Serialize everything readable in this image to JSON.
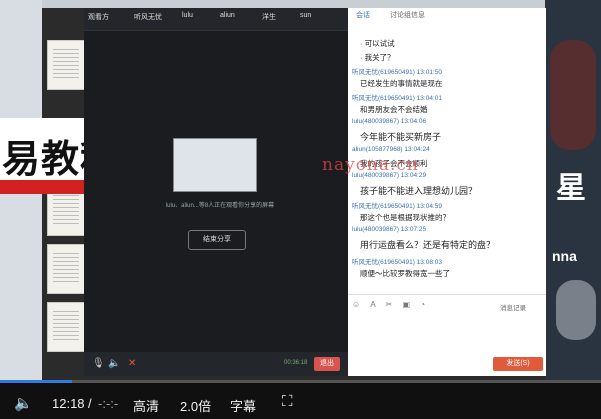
{
  "video_window": {
    "tabs": [
      "观看方",
      "听风无忧",
      "lulu",
      "aliun",
      "洋生",
      "sun"
    ],
    "share_message": "lulu、aliun...等8人正在观看你分享的屏幕",
    "end_share_button": "结束分享",
    "exit_button": "退出",
    "timer": "00:36:18"
  },
  "chat": {
    "tabs": [
      "会话",
      "讨论组信息"
    ],
    "messages": [
      {
        "meta": "",
        "text": "· 可以试试"
      },
      {
        "meta": "",
        "text": "· 我关了？"
      },
      {
        "meta": "听风无忧(619650491)  13:01:50",
        "text": "已经发生的事情就是现在"
      },
      {
        "meta": "听风无忧(619650491)  13:04:01",
        "text": "和男朋友会不会结婚"
      },
      {
        "meta": "lulu(480039867)  13:04:06",
        "text": "今年能不能买新房子"
      },
      {
        "meta": "aliun(105877968)  13:04:24",
        "text": "我的孩子会不会顺利"
      },
      {
        "meta": "lulu(480039867)  13:04:29",
        "text": "孩子能不能进入理想幼儿园？"
      },
      {
        "meta": "听风无忧(619650491)  13:04:59",
        "text": "那这个也是根据现状推的？"
      },
      {
        "meta": "lulu(480039867)  13:07:25",
        "text": "用行运盘看么？还是有特定的盘？"
      },
      {
        "meta": "听风无忧(619650491)  13:08:03",
        "text": "顺便～比较罗教得宽一些了"
      }
    ],
    "chat_history_label": "消息记录",
    "send_button": "发送(S)"
  },
  "watermark": "nayona.cn",
  "promo": {
    "text": "易教程"
  },
  "decor": {
    "star": "星",
    "anna": "nna"
  },
  "player": {
    "time_current": "12:18",
    "time_separator": "/",
    "time_total": "-:-:-",
    "quality": "高清",
    "speed": "2.0倍",
    "subtitles": "字幕",
    "progress_fraction": 0.12
  }
}
